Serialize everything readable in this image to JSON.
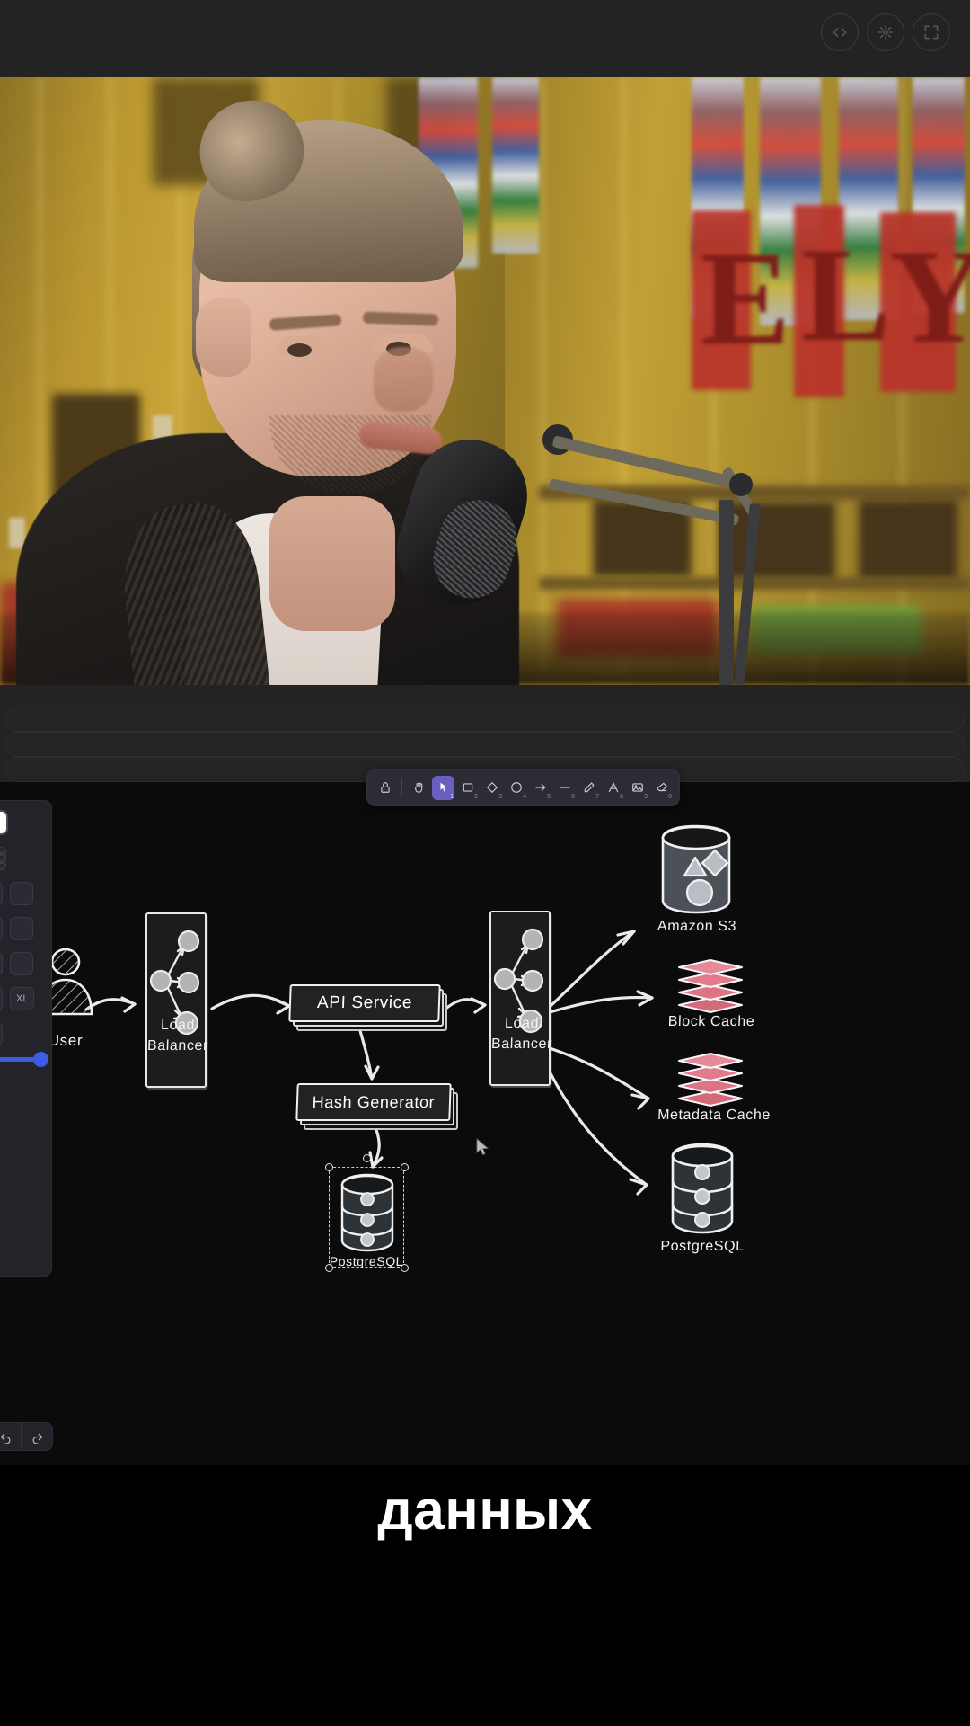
{
  "topbar": {
    "buttons": [
      {
        "name": "code-icon",
        "label": "Code"
      },
      {
        "name": "sparkle-icon",
        "label": "Effects"
      },
      {
        "name": "fullscreen-icon",
        "label": "Fullscreen"
      }
    ]
  },
  "video": {
    "description": "Podcast interview clip: young man with blond hair in a top bun speaking into a studio microphone, warm gold wood-panelled room with red FLY banner and stained glass behind him."
  },
  "skeleton": {
    "bars": 3
  },
  "toolbar": {
    "tools": [
      {
        "name": "lock-tool",
        "label": "Lock",
        "key": "",
        "active": false
      },
      {
        "name": "hand-tool",
        "label": "Hand",
        "key": "",
        "active": false
      },
      {
        "name": "selection-tool",
        "label": "Selection",
        "key": "1",
        "active": true
      },
      {
        "name": "rectangle-tool",
        "label": "Rectangle",
        "key": "2",
        "active": false
      },
      {
        "name": "diamond-tool",
        "label": "Diamond",
        "key": "3",
        "active": false
      },
      {
        "name": "ellipse-tool",
        "label": "Ellipse",
        "key": "4",
        "active": false
      },
      {
        "name": "arrow-tool",
        "label": "Arrow",
        "key": "5",
        "active": false
      },
      {
        "name": "line-tool",
        "label": "Line",
        "key": "6",
        "active": false
      },
      {
        "name": "draw-tool",
        "label": "Draw",
        "key": "7",
        "active": false
      },
      {
        "name": "text-tool",
        "label": "Text",
        "key": "8",
        "active": false
      },
      {
        "name": "image-tool",
        "label": "Image",
        "key": "9",
        "active": false
      },
      {
        "name": "eraser-tool",
        "label": "Eraser",
        "key": "0",
        "active": false
      }
    ]
  },
  "properties": {
    "stroke_swatch": "#e8811a",
    "stroke_selected": "#ffffff",
    "background_swatch": "#8a5a10",
    "background_selected": "transparent",
    "font_size_label": "XL",
    "opacity_value": "100",
    "action_icons": [
      "layers-icon",
      "align-horizontal-icon",
      "align-vertical-icon"
    ]
  },
  "history": {
    "undo_label": "Undo",
    "redo_label": "Redo"
  },
  "diagram": {
    "nodes": [
      {
        "id": "user",
        "label": "User",
        "type": "actor"
      },
      {
        "id": "lb1",
        "label": "Load\nBalancer",
        "line1": "Load",
        "line2": "Balancer",
        "type": "load-balancer"
      },
      {
        "id": "api",
        "label": "API Service",
        "type": "service-stack"
      },
      {
        "id": "hash",
        "label": "Hash Generator",
        "type": "service-stack"
      },
      {
        "id": "hashdb",
        "label": "PostgreSQL",
        "type": "database",
        "selected": true
      },
      {
        "id": "lb2",
        "label": "Load\nBalancer",
        "line1": "Load",
        "line2": "Balancer",
        "type": "load-balancer"
      },
      {
        "id": "s3",
        "label": "Amazon S3",
        "type": "object-store"
      },
      {
        "id": "blockcache",
        "label": "Block Cache",
        "type": "cache"
      },
      {
        "id": "metadatacache",
        "label": "Metadata Cache",
        "type": "cache"
      },
      {
        "id": "postgres",
        "label": "PostgreSQL",
        "type": "database"
      }
    ],
    "edges": [
      {
        "from": "user",
        "to": "lb1"
      },
      {
        "from": "lb1",
        "to": "api"
      },
      {
        "from": "api",
        "to": "hash"
      },
      {
        "from": "hash",
        "to": "hashdb"
      },
      {
        "from": "api",
        "to": "lb2"
      },
      {
        "from": "lb2",
        "to": "s3"
      },
      {
        "from": "lb2",
        "to": "blockcache"
      },
      {
        "from": "lb2",
        "to": "metadatacache"
      },
      {
        "from": "lb2",
        "to": "postgres"
      }
    ],
    "colors": {
      "stroke": "#efefef",
      "node_fill": "#1c1c1c",
      "cache_fill": "#d4697a",
      "canvas": "#0b0b0b"
    }
  },
  "caption": {
    "text": "данных"
  }
}
